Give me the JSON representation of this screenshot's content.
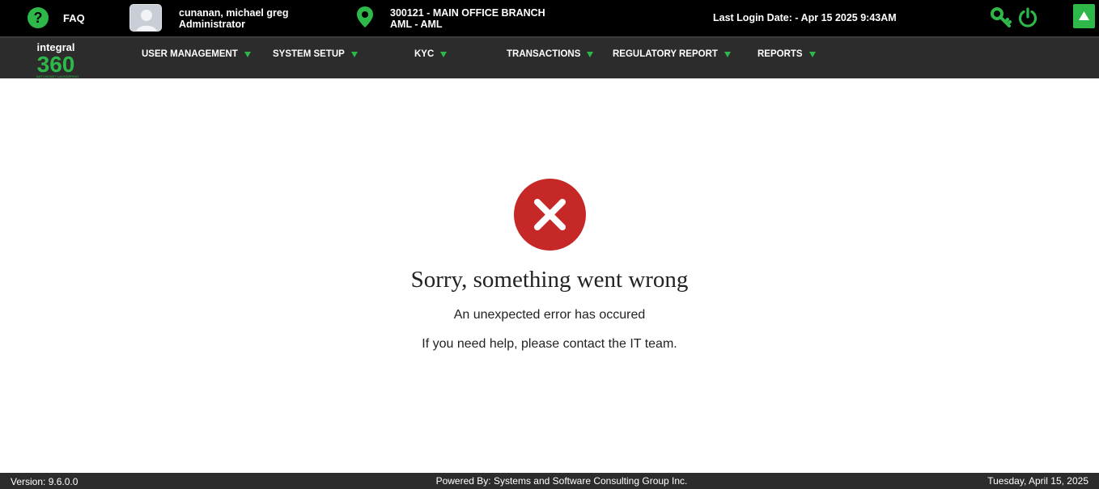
{
  "topbar": {
    "faq_label": "FAQ",
    "user_name": "cunanan, michael greg",
    "user_role": "Administrator",
    "branch_line1": "300121 - MAIN OFFICE BRANCH",
    "branch_line2": "AML - AML",
    "last_login": "Last Login Date: - Apr 15 2025 9:43AM",
    "icons": [
      "question-circle-icon",
      "user-avatar",
      "location-pin-icon",
      "key-icon",
      "power-icon",
      "arrow-up-icon"
    ]
  },
  "logo": {
    "line1": "integral",
    "line2": "360",
    "tagline": "ANTI-MONEY LAUNDERING"
  },
  "nav": {
    "items": [
      {
        "label": "USER MANAGEMENT"
      },
      {
        "label": "SYSTEM SETUP"
      },
      {
        "label": "KYC"
      },
      {
        "label": "TRANSACTIONS"
      },
      {
        "label": "REGULATORY REPORT"
      },
      {
        "label": "REPORTS"
      }
    ]
  },
  "error": {
    "title": "Sorry, something went wrong",
    "subtitle": "An unexpected error has occured",
    "help": "If you need help, please contact the IT team."
  },
  "footer": {
    "version": "Version: 9.6.0.0",
    "powered_by": "Powered By: Systems and Software Consulting Group Inc.",
    "date": "Tuesday, April 15, 2025"
  },
  "colors": {
    "accent_green": "#2fb84a",
    "error_red": "#c62828",
    "topbar_bg": "#000000",
    "nav_bg": "#2c2c2c"
  }
}
